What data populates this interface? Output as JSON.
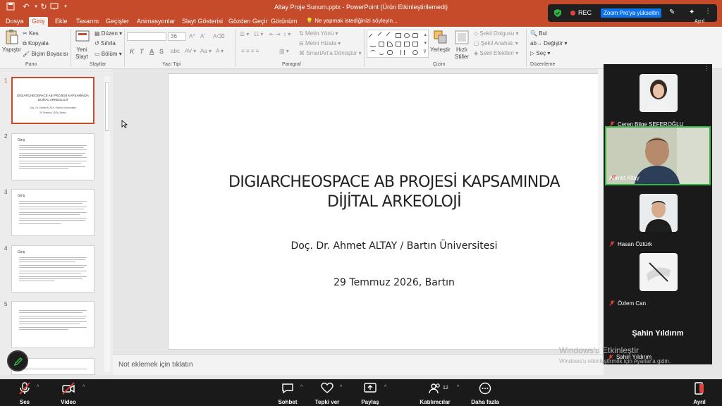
{
  "window": {
    "title": "Altay Proje Sunum.pptx  -  PowerPoint (Ürün Etkinleştirilemedi)"
  },
  "tabs": [
    "Dosya",
    "Giriş",
    "Ekle",
    "Tasarım",
    "Geçişler",
    "Animasyonlar",
    "Slayt Gösterisi",
    "Gözden Geçir",
    "Görünüm"
  ],
  "active_tab": "Giriş",
  "tell_me": "Ne yapmak istediğinizi söyleyin...",
  "ribbon": {
    "clipboard": {
      "paste": "Yapıştır",
      "cut": "Kes",
      "copy": "Kopyala",
      "format_painter": "Biçim Boyacısı",
      "label": "Pano"
    },
    "slides": {
      "new_slide": "Yeni Slayt",
      "layout": "Düzen",
      "reset": "Sıfırla",
      "section": "Bölüm",
      "label": "Slaytlar"
    },
    "font": {
      "size": "36",
      "bold": "K",
      "italic": "T",
      "underline": "A",
      "strike": "S",
      "label": "Yazı Tipi"
    },
    "paragraph": {
      "text_direction": "Metin Yönü",
      "align_text": "Metni Hizala",
      "smartart": "SmartArt'a Dönüştür",
      "label": "Paragraf"
    },
    "drawing": {
      "arrange": "Yerleştir",
      "quick_styles": "Hızlı Stiller",
      "shape_fill": "Şekil Dolgusu",
      "shape_outline": "Şekil Anahatı",
      "shape_effects": "Şekil Efektleri",
      "label": "Çizim"
    },
    "editing": {
      "find": "Bul",
      "replace": "Değiştir",
      "select": "Seç",
      "label": "Düzenleme"
    }
  },
  "thumbnails": [
    {
      "num": "1",
      "head": "",
      "selected": true
    },
    {
      "num": "2",
      "head": "Giriş",
      "selected": false
    },
    {
      "num": "3",
      "head": "Giriş",
      "selected": false
    },
    {
      "num": "4",
      "head": "Giriş",
      "selected": false
    },
    {
      "num": "5",
      "head": "",
      "selected": false
    }
  ],
  "thumb1": {
    "title": "DIGIARCHEOSPACE AB PROJESİ KAPSAMINDA DİJİTAL ARKEOLOJİ",
    "author": "Doç. Dr. Ahmet ALTAY / Bartın Üniversitesi",
    "date": "29 Temmuz 2026, Bartın"
  },
  "slide": {
    "title_line1": "DIGIARCHEOSPACE AB PROJESİ KAPSAMINDA",
    "title_line2": "DİJİTAL ARKEOLOJİ",
    "author": "Doç. Dr. Ahmet ALTAY / Bartın Üniversitesi",
    "date": "29 Temmuz 2026, Bartın"
  },
  "notes_placeholder": "Not eklemek için tıklatın",
  "zoom": {
    "rec": "REC",
    "upgrade": "Zoom Pro'ya yükseltin",
    "leave_top": "Ayrıl",
    "participants": [
      {
        "name": "Ceren Bilge SEFEROĞLU",
        "active": false,
        "photo": "woman"
      },
      {
        "name": "Ahmet Altay",
        "active": true,
        "photo": "video"
      },
      {
        "name": "Hasan Öztürk",
        "active": false,
        "photo": "man"
      },
      {
        "name": "Özlem Can",
        "active": false,
        "photo": "hand"
      }
    ],
    "speaker_big": "Şahin Yıldırım",
    "speaker_small": "Şahin Yıldırım",
    "toolbar": {
      "audio": "Ses",
      "video": "Video",
      "chat": "Sohbet",
      "react": "Tepki ver",
      "share": "Paylaş",
      "participants": "Katılımcılar",
      "participants_count": "12",
      "more": "Daha fazla",
      "leave": "Ayrıl"
    }
  },
  "windows_activation": {
    "line1": "Windows'u Etkinleştir",
    "line2": "Windows'u etkinleştirmek için Ayarlar'a gidin."
  },
  "colors": {
    "office_accent": "#c54b2a",
    "zoom_active": "#2fb843",
    "zoom_blue": "#0e72ed",
    "rec_red": "#e0433b",
    "mic_muted": "#e0433b"
  }
}
